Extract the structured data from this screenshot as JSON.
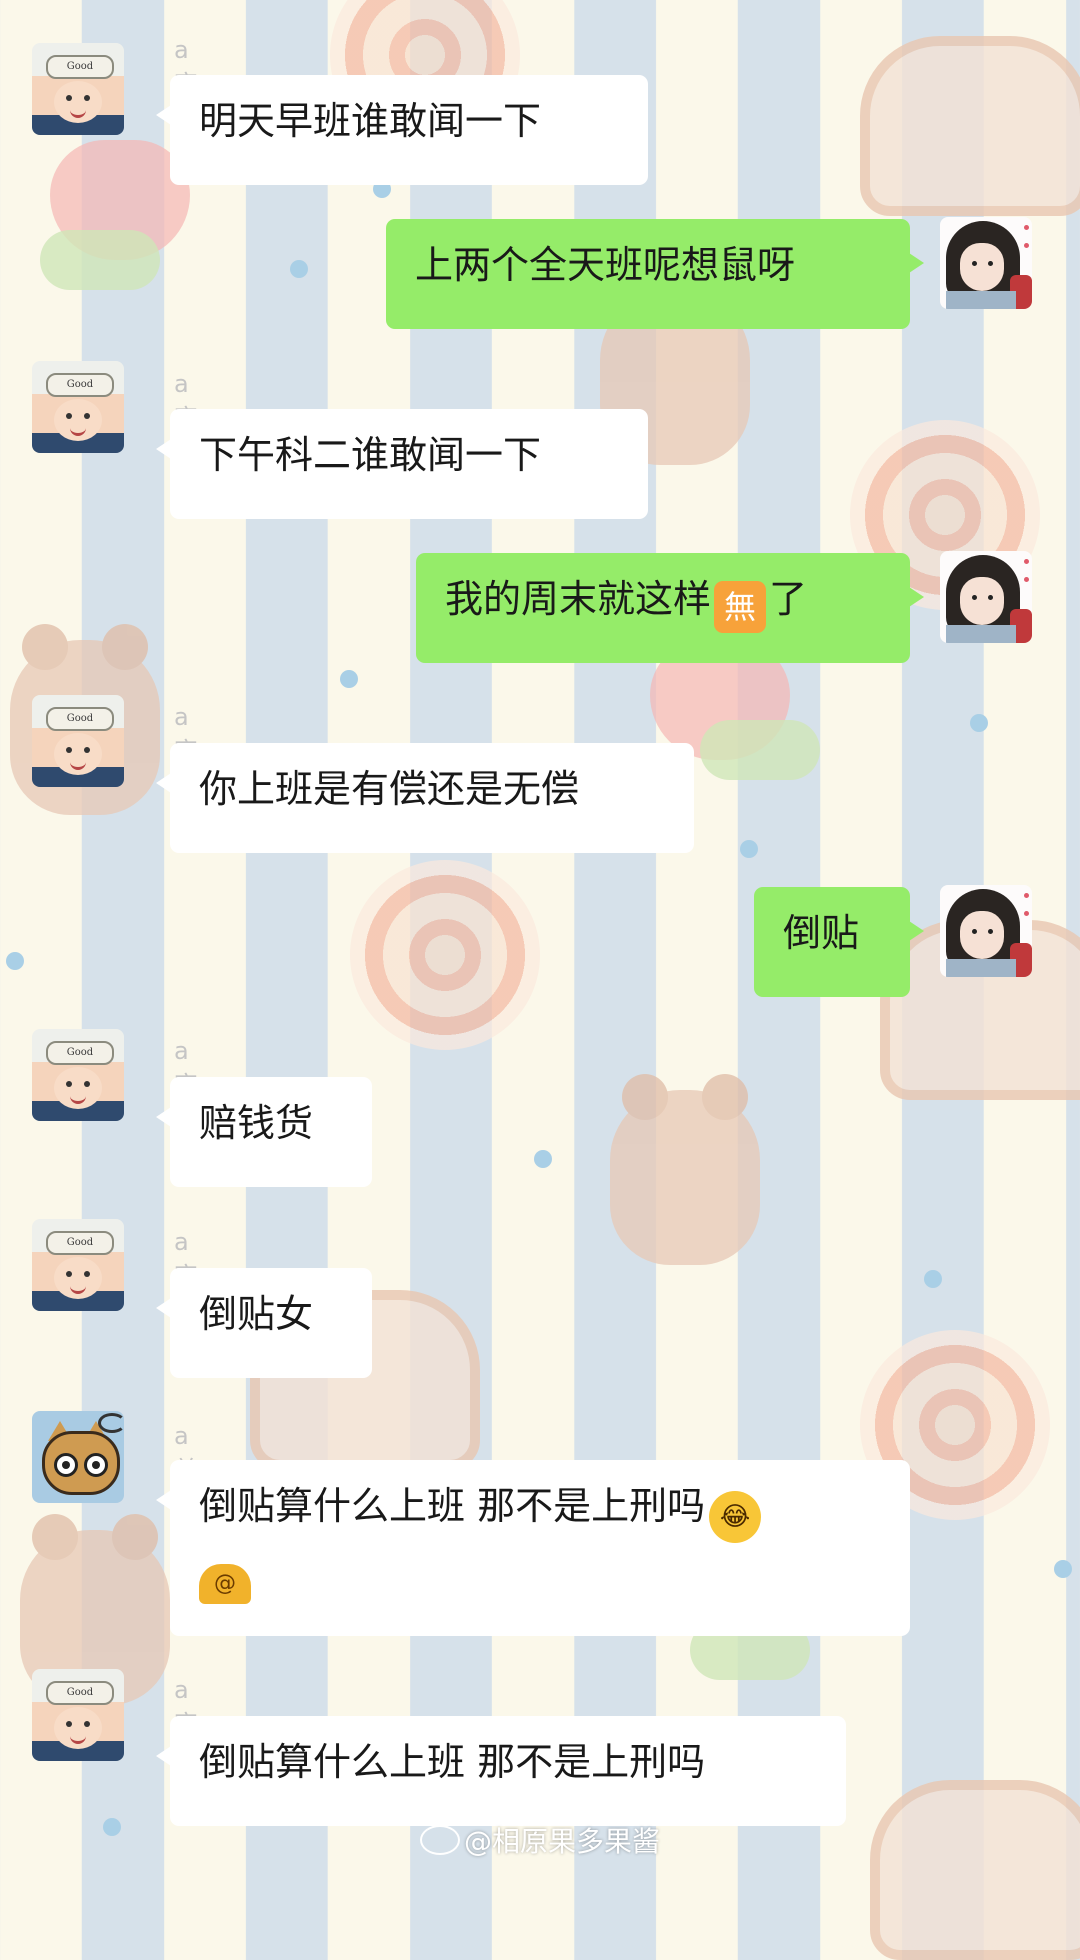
{
  "contacts": {
    "wanru": {
      "name": "a宛如",
      "hat_text": "Good Morning"
    },
    "yangyang": {
      "name": "a羊杨"
    }
  },
  "messages": [
    {
      "sender": "a宛如",
      "text": "明天早班谁敢闻一下"
    },
    {
      "sender": "me",
      "text": "上两个全天班呢想鼠呀"
    },
    {
      "sender": "a宛如",
      "text": "下午科二谁敢闻一下"
    },
    {
      "sender": "me",
      "text_before": "我的周末就这样",
      "emoji": "無",
      "text_after": "了"
    },
    {
      "sender": "a宛如",
      "text": "你上班是有偿还是无偿"
    },
    {
      "sender": "me",
      "text": "倒贴"
    },
    {
      "sender": "a宛如",
      "text": "赔钱货"
    },
    {
      "sender": "a宛如",
      "text": "倒贴女"
    },
    {
      "sender": "a羊杨",
      "text": "倒贴算什么上班 那不是上刑吗",
      "emojis": [
        "face-with-tears-of-joy",
        "snail"
      ]
    },
    {
      "sender": "a宛如",
      "text": "倒贴算什么上班 那不是上刑吗"
    }
  ],
  "watermark": {
    "text": "@相原果多果酱"
  },
  "colors": {
    "incoming_bubble": "#ffffff",
    "outgoing_bubble": "#95ec69",
    "name_text": "#c5c5c5"
  }
}
